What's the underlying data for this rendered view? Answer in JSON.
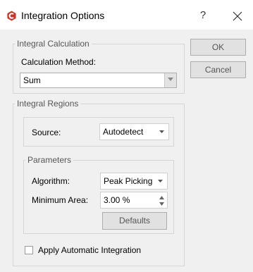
{
  "window": {
    "title": "Integration Options",
    "help_glyph": "?",
    "close_glyph": "×",
    "app_icon": "app-logo-icon",
    "accent": "#c0392b"
  },
  "integral_calculation": {
    "legend": "Integral Calculation",
    "method_label": "Calculation Method:",
    "method_value": "Sum"
  },
  "integral_regions": {
    "legend": "Integral Regions",
    "source_label": "Source:",
    "source_value": "Autodetect",
    "parameters": {
      "legend": "Parameters",
      "algorithm_label": "Algorithm:",
      "algorithm_value": "Peak Picking",
      "min_area_label": "Minimum Area:",
      "min_area_value": "3.00 %",
      "defaults_label": "Defaults"
    },
    "auto_integration_label": "Apply Automatic Integration",
    "auto_integration_checked": false
  },
  "buttons": {
    "ok": "OK",
    "cancel": "Cancel"
  }
}
